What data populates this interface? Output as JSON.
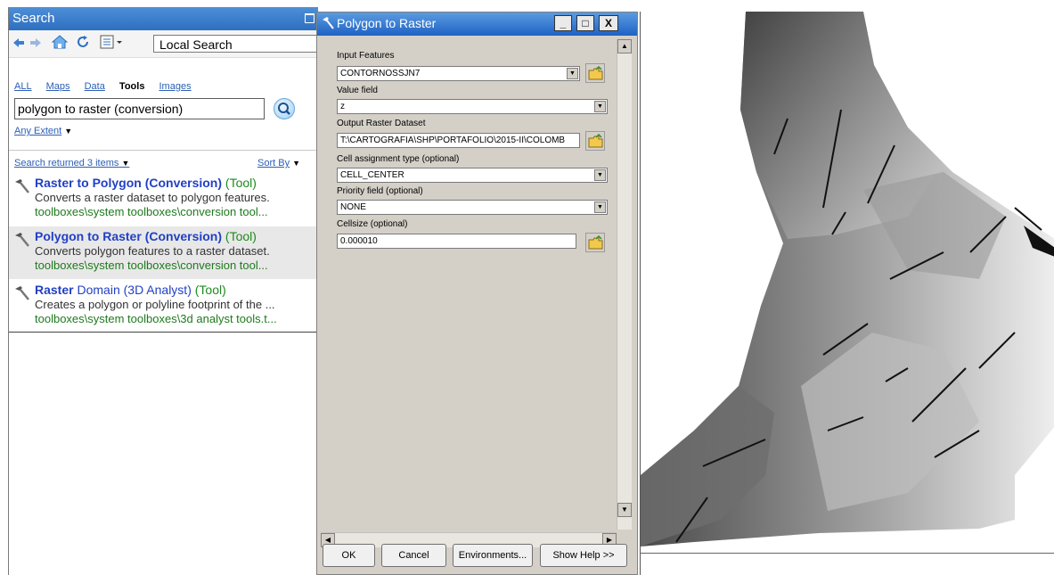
{
  "search": {
    "title": "Search",
    "local_search": "Local Search",
    "filters": [
      "ALL",
      "Maps",
      "Data",
      "Tools",
      "Images"
    ],
    "active_filter": "Tools",
    "query": "polygon to raster (conversion)",
    "extent": "Any Extent",
    "result_count": "Search returned 3 items",
    "sort_by": "Sort By",
    "results": [
      {
        "name": "Raster to Polygon",
        "category": "(Conversion)",
        "type": "(Tool)",
        "description": "Converts a raster dataset to polygon features.",
        "path": "toolboxes\\system toolboxes\\conversion tool..."
      },
      {
        "name": "Polygon to Raster",
        "category": "(Conversion)",
        "type": "(Tool)",
        "description": "Converts polygon features to a raster dataset.",
        "path": "toolboxes\\system toolboxes\\conversion tool..."
      },
      {
        "name": "Raster",
        "category": "Domain (3D Analyst)",
        "type": "(Tool)",
        "description": "Creates a polygon or polyline footprint of the ...",
        "path": "toolboxes\\system toolboxes\\3d analyst tools.t..."
      }
    ]
  },
  "dialog": {
    "title": "Polygon to Raster",
    "fields": {
      "input_features_label": "Input Features",
      "input_features_value": "CONTORNOSSJN7",
      "value_field_label": "Value field",
      "value_field_value": "z",
      "output_label": "Output Raster Dataset",
      "output_value": "T:\\CARTOGRAFIA\\SHP\\PORTAFOLIO\\2015-II\\COLOMB",
      "cell_assignment_label": "Cell assignment type (optional)",
      "cell_assignment_value": "CELL_CENTER",
      "priority_label": "Priority field (optional)",
      "priority_value": "NONE",
      "cellsize_label": "Cellsize (optional)",
      "cellsize_value": "0.000010"
    },
    "buttons": {
      "ok": "OK",
      "cancel": "Cancel",
      "environments": "Environments...",
      "help": "Show Help >>"
    },
    "window_buttons": {
      "minimize": "_",
      "maximize": "□",
      "close": "X"
    }
  },
  "icons": {
    "back": "back-arrow-icon",
    "forward": "forward-arrow-icon",
    "home": "home-icon",
    "refresh": "refresh-icon",
    "view": "list-view-icon",
    "search": "search-magnifier-icon",
    "tool": "hammer-icon",
    "folder": "open-folder-icon"
  },
  "colors": {
    "title_bar": "#2d6fc0",
    "link": "#2b5fb5",
    "result_title": "#2240c4",
    "path_green": "#1e7a1e",
    "dialog_bg": "#d4d0c8"
  }
}
